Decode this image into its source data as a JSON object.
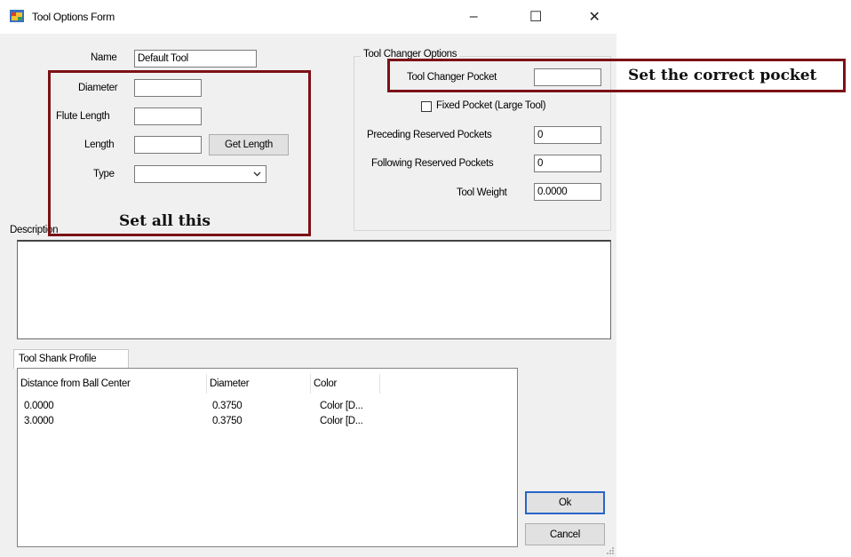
{
  "window": {
    "title": "Tool Options Form",
    "controls": {
      "minimize": "–",
      "maximize": "☐",
      "close": "✕"
    }
  },
  "tool": {
    "name_label": "Name",
    "name_value": "Default Tool",
    "diameter_label": "Diameter",
    "diameter_value": "",
    "flute_length_label": "Flute Length",
    "flute_length_value": "",
    "length_label": "Length",
    "length_value": "",
    "get_length_button": "Get Length",
    "type_label": "Type",
    "type_value": ""
  },
  "tool_changer": {
    "group_title": "Tool Changer Options",
    "pocket_label": "Tool Changer Pocket",
    "pocket_value": "",
    "fixed_pocket_label": "Fixed Pocket (Large Tool)",
    "fixed_pocket_checked": false,
    "preceding_label": "Preceding Reserved Pockets",
    "preceding_value": "0",
    "following_label": "Following Reserved Pockets",
    "following_value": "0",
    "weight_label": "Tool Weight",
    "weight_value": "0.0000"
  },
  "description": {
    "label": "Description",
    "value": ""
  },
  "shank_profile": {
    "tab_label": "Tool Shank Profile",
    "columns": [
      "Distance from Ball Center",
      "Diameter",
      "Color"
    ],
    "rows": [
      [
        "0.0000",
        "0.3750",
        "Color [D..."
      ],
      [
        "3.0000",
        "0.3750",
        "Color [D..."
      ]
    ]
  },
  "buttons": {
    "ok": "Ok",
    "cancel": "Cancel"
  },
  "annotations": {
    "left_note": "Set all this",
    "right_note": "Set the correct pocket",
    "color": "#7b1117"
  }
}
